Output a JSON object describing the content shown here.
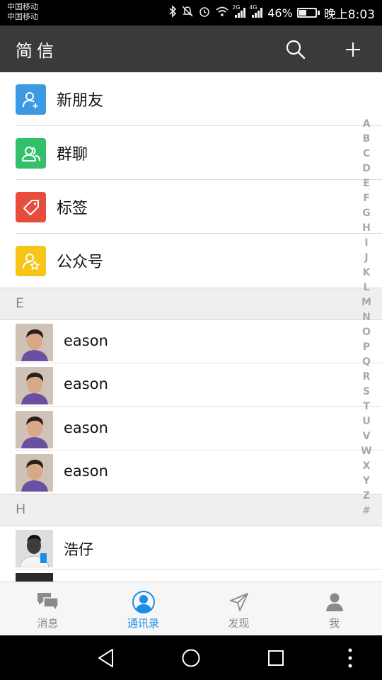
{
  "status_bar": {
    "carrier1": "中国移动",
    "carrier2": "中国移动",
    "network1": "2G",
    "network2": "4G",
    "battery_percent": "46%",
    "battery_level": 0.46,
    "time": "晚上8:03",
    "icons": [
      "bluetooth-icon",
      "mute-icon",
      "alarm-icon",
      "wifi-icon",
      "signal-icon",
      "signal-icon",
      "battery-icon"
    ]
  },
  "app_bar": {
    "title": "简信",
    "icons": [
      "search-icon",
      "plus-icon"
    ],
    "background": "#3a3a3c"
  },
  "functions": [
    {
      "label": "新朋友",
      "icon": "add-friend-icon",
      "color": "#3b9ae1"
    },
    {
      "label": "群聊",
      "icon": "group-icon",
      "color": "#33c06a"
    },
    {
      "label": "标签",
      "icon": "tag-icon",
      "color": "#e84c3d"
    },
    {
      "label": "公众号",
      "icon": "official-account-icon",
      "color": "#f5c518"
    }
  ],
  "sections": [
    {
      "header": "E",
      "contacts": [
        {
          "name": "eason",
          "avatar": "avatar-photo"
        },
        {
          "name": "eason",
          "avatar": "avatar-photo"
        },
        {
          "name": "eason",
          "avatar": "avatar-photo"
        },
        {
          "name": "eason",
          "avatar": "avatar-photo"
        }
      ]
    },
    {
      "header": "H",
      "contacts": [
        {
          "name": "浩仔",
          "avatar": "avatar-photo"
        }
      ]
    }
  ],
  "alpha_index": [
    "A",
    "B",
    "C",
    "D",
    "E",
    "F",
    "G",
    "H",
    "I",
    "J",
    "K",
    "L",
    "M",
    "N",
    "O",
    "P",
    "Q",
    "R",
    "S",
    "T",
    "U",
    "V",
    "W",
    "X",
    "Y",
    "Z",
    "#"
  ],
  "tabs": [
    {
      "label": "消息",
      "icon": "chat-icon",
      "active": false
    },
    {
      "label": "通讯录",
      "icon": "contacts-icon",
      "active": true
    },
    {
      "label": "发现",
      "icon": "discover-icon",
      "active": false
    },
    {
      "label": "我",
      "icon": "me-icon",
      "active": false
    }
  ],
  "colors": {
    "accent": "#1a8ee6",
    "tab_inactive": "#8a8a8a"
  },
  "nav_bar": {
    "icons": [
      "back-icon",
      "home-icon",
      "recents-icon",
      "more-icon"
    ]
  }
}
